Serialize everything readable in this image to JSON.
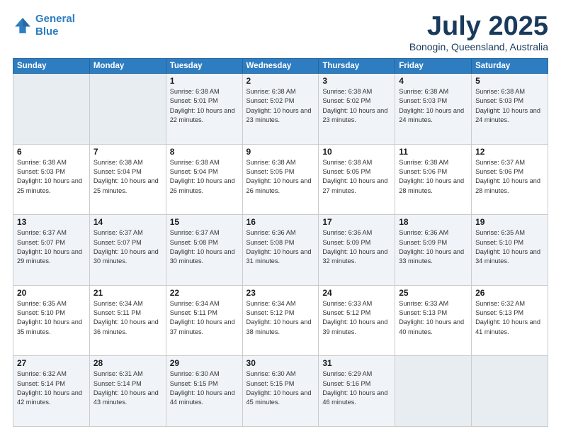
{
  "header": {
    "logo_line1": "General",
    "logo_line2": "Blue",
    "month": "July 2025",
    "location": "Bonogin, Queensland, Australia"
  },
  "days_of_week": [
    "Sunday",
    "Monday",
    "Tuesday",
    "Wednesday",
    "Thursday",
    "Friday",
    "Saturday"
  ],
  "weeks": [
    [
      {
        "day": "",
        "empty": true
      },
      {
        "day": "",
        "empty": true
      },
      {
        "day": "1",
        "sunrise": "Sunrise: 6:38 AM",
        "sunset": "Sunset: 5:01 PM",
        "daylight": "Daylight: 10 hours and 22 minutes."
      },
      {
        "day": "2",
        "sunrise": "Sunrise: 6:38 AM",
        "sunset": "Sunset: 5:02 PM",
        "daylight": "Daylight: 10 hours and 23 minutes."
      },
      {
        "day": "3",
        "sunrise": "Sunrise: 6:38 AM",
        "sunset": "Sunset: 5:02 PM",
        "daylight": "Daylight: 10 hours and 23 minutes."
      },
      {
        "day": "4",
        "sunrise": "Sunrise: 6:38 AM",
        "sunset": "Sunset: 5:03 PM",
        "daylight": "Daylight: 10 hours and 24 minutes."
      },
      {
        "day": "5",
        "sunrise": "Sunrise: 6:38 AM",
        "sunset": "Sunset: 5:03 PM",
        "daylight": "Daylight: 10 hours and 24 minutes."
      }
    ],
    [
      {
        "day": "6",
        "sunrise": "Sunrise: 6:38 AM",
        "sunset": "Sunset: 5:03 PM",
        "daylight": "Daylight: 10 hours and 25 minutes."
      },
      {
        "day": "7",
        "sunrise": "Sunrise: 6:38 AM",
        "sunset": "Sunset: 5:04 PM",
        "daylight": "Daylight: 10 hours and 25 minutes."
      },
      {
        "day": "8",
        "sunrise": "Sunrise: 6:38 AM",
        "sunset": "Sunset: 5:04 PM",
        "daylight": "Daylight: 10 hours and 26 minutes."
      },
      {
        "day": "9",
        "sunrise": "Sunrise: 6:38 AM",
        "sunset": "Sunset: 5:05 PM",
        "daylight": "Daylight: 10 hours and 26 minutes."
      },
      {
        "day": "10",
        "sunrise": "Sunrise: 6:38 AM",
        "sunset": "Sunset: 5:05 PM",
        "daylight": "Daylight: 10 hours and 27 minutes."
      },
      {
        "day": "11",
        "sunrise": "Sunrise: 6:38 AM",
        "sunset": "Sunset: 5:06 PM",
        "daylight": "Daylight: 10 hours and 28 minutes."
      },
      {
        "day": "12",
        "sunrise": "Sunrise: 6:37 AM",
        "sunset": "Sunset: 5:06 PM",
        "daylight": "Daylight: 10 hours and 28 minutes."
      }
    ],
    [
      {
        "day": "13",
        "sunrise": "Sunrise: 6:37 AM",
        "sunset": "Sunset: 5:07 PM",
        "daylight": "Daylight: 10 hours and 29 minutes."
      },
      {
        "day": "14",
        "sunrise": "Sunrise: 6:37 AM",
        "sunset": "Sunset: 5:07 PM",
        "daylight": "Daylight: 10 hours and 30 minutes."
      },
      {
        "day": "15",
        "sunrise": "Sunrise: 6:37 AM",
        "sunset": "Sunset: 5:08 PM",
        "daylight": "Daylight: 10 hours and 30 minutes."
      },
      {
        "day": "16",
        "sunrise": "Sunrise: 6:36 AM",
        "sunset": "Sunset: 5:08 PM",
        "daylight": "Daylight: 10 hours and 31 minutes."
      },
      {
        "day": "17",
        "sunrise": "Sunrise: 6:36 AM",
        "sunset": "Sunset: 5:09 PM",
        "daylight": "Daylight: 10 hours and 32 minutes."
      },
      {
        "day": "18",
        "sunrise": "Sunrise: 6:36 AM",
        "sunset": "Sunset: 5:09 PM",
        "daylight": "Daylight: 10 hours and 33 minutes."
      },
      {
        "day": "19",
        "sunrise": "Sunrise: 6:35 AM",
        "sunset": "Sunset: 5:10 PM",
        "daylight": "Daylight: 10 hours and 34 minutes."
      }
    ],
    [
      {
        "day": "20",
        "sunrise": "Sunrise: 6:35 AM",
        "sunset": "Sunset: 5:10 PM",
        "daylight": "Daylight: 10 hours and 35 minutes."
      },
      {
        "day": "21",
        "sunrise": "Sunrise: 6:34 AM",
        "sunset": "Sunset: 5:11 PM",
        "daylight": "Daylight: 10 hours and 36 minutes."
      },
      {
        "day": "22",
        "sunrise": "Sunrise: 6:34 AM",
        "sunset": "Sunset: 5:11 PM",
        "daylight": "Daylight: 10 hours and 37 minutes."
      },
      {
        "day": "23",
        "sunrise": "Sunrise: 6:34 AM",
        "sunset": "Sunset: 5:12 PM",
        "daylight": "Daylight: 10 hours and 38 minutes."
      },
      {
        "day": "24",
        "sunrise": "Sunrise: 6:33 AM",
        "sunset": "Sunset: 5:12 PM",
        "daylight": "Daylight: 10 hours and 39 minutes."
      },
      {
        "day": "25",
        "sunrise": "Sunrise: 6:33 AM",
        "sunset": "Sunset: 5:13 PM",
        "daylight": "Daylight: 10 hours and 40 minutes."
      },
      {
        "day": "26",
        "sunrise": "Sunrise: 6:32 AM",
        "sunset": "Sunset: 5:13 PM",
        "daylight": "Daylight: 10 hours and 41 minutes."
      }
    ],
    [
      {
        "day": "27",
        "sunrise": "Sunrise: 6:32 AM",
        "sunset": "Sunset: 5:14 PM",
        "daylight": "Daylight: 10 hours and 42 minutes."
      },
      {
        "day": "28",
        "sunrise": "Sunrise: 6:31 AM",
        "sunset": "Sunset: 5:14 PM",
        "daylight": "Daylight: 10 hours and 43 minutes."
      },
      {
        "day": "29",
        "sunrise": "Sunrise: 6:30 AM",
        "sunset": "Sunset: 5:15 PM",
        "daylight": "Daylight: 10 hours and 44 minutes."
      },
      {
        "day": "30",
        "sunrise": "Sunrise: 6:30 AM",
        "sunset": "Sunset: 5:15 PM",
        "daylight": "Daylight: 10 hours and 45 minutes."
      },
      {
        "day": "31",
        "sunrise": "Sunrise: 6:29 AM",
        "sunset": "Sunset: 5:16 PM",
        "daylight": "Daylight: 10 hours and 46 minutes."
      },
      {
        "day": "",
        "empty": true
      },
      {
        "day": "",
        "empty": true
      }
    ]
  ]
}
